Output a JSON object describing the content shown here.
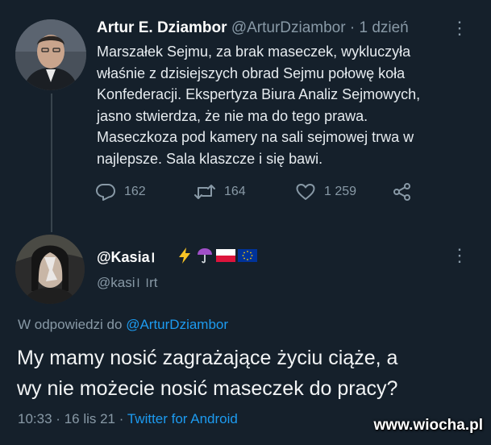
{
  "tweet1": {
    "author_name": "Artur E. Dziambor",
    "handle": "@ArturDziambor",
    "separator": "·",
    "time": "1 dzień",
    "lines": [
      "Marszałek Sejmu, za brak maseczek,  wykluczyła",
      "właśnie z dzisiejszych obrad Sejmu połowę koła",
      "Konfederacji. Ekspertyza Biura Analiz Sejmowych,",
      "jasno stwierdza, że nie ma do tego prawa.",
      "Maseczkoza pod kamery na sali sejmowej trwa w",
      "najlepsze. Sala klaszcze i się bawi."
    ],
    "replies": "162",
    "retweets": "164",
    "likes": "1 259"
  },
  "tweet2": {
    "author_name": "@Kasia।",
    "handle": "@kasi। ।rt",
    "reply_prefix": "W odpowiedzi do",
    "reply_to": "@ArturDziambor",
    "lines": [
      "My mamy nosić zagrażające życiu ciąże, a",
      "wy nie możecie nosić maseczek do pracy?"
    ],
    "time": "10:33",
    "date": "16 lis 21",
    "separator": "·",
    "source": "Twitter for Android"
  },
  "more_glyph": "⋮",
  "watermark": "www.wiocha.pl",
  "colors": {
    "background": "#15202b",
    "accent": "#1d9bf0",
    "muted": "#8899a6"
  },
  "icons": [
    "reply-icon",
    "retweet-icon",
    "like-icon",
    "share-icon",
    "lightning-emoji",
    "umbrella-emoji",
    "poland-flag-emoji",
    "eu-flag-emoji",
    "more-icon"
  ]
}
